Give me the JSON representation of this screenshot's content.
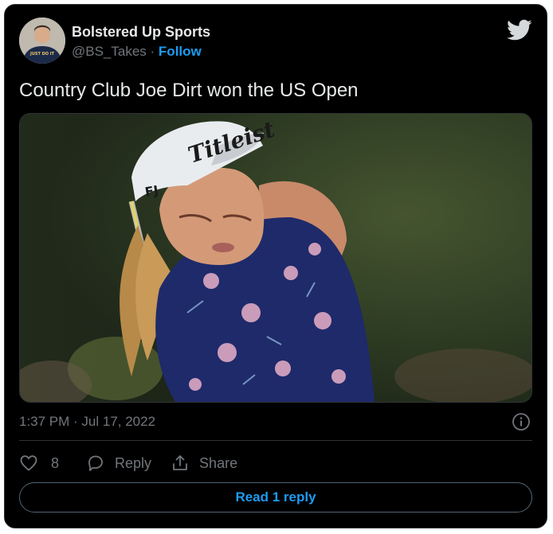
{
  "author": {
    "name": "Bolstered Up Sports",
    "handle": "@BS_Takes",
    "separator": " · ",
    "follow_label": "Follow",
    "avatar_shirt_text": "JUST DO IT"
  },
  "tweet": {
    "text": "Country Club Joe Dirt won the US Open",
    "image_icon": "photo-golfer",
    "cap_logo_text": "Titleist",
    "cap_side_text": "FJ"
  },
  "meta": {
    "timestamp": "1:37 PM · Jul 17, 2022"
  },
  "actions": {
    "like_count": "8",
    "reply_label": "Reply",
    "share_label": "Share"
  },
  "read_replies_label": "Read 1 reply",
  "colors": {
    "background": "#000000",
    "text": "#e7e9ea",
    "muted": "#71767b",
    "accent": "#1d9bf0",
    "border": "#2f3336"
  },
  "icons": [
    "twitter-bird-icon",
    "info-icon",
    "heart-icon",
    "reply-bubble-icon",
    "share-icon"
  ]
}
